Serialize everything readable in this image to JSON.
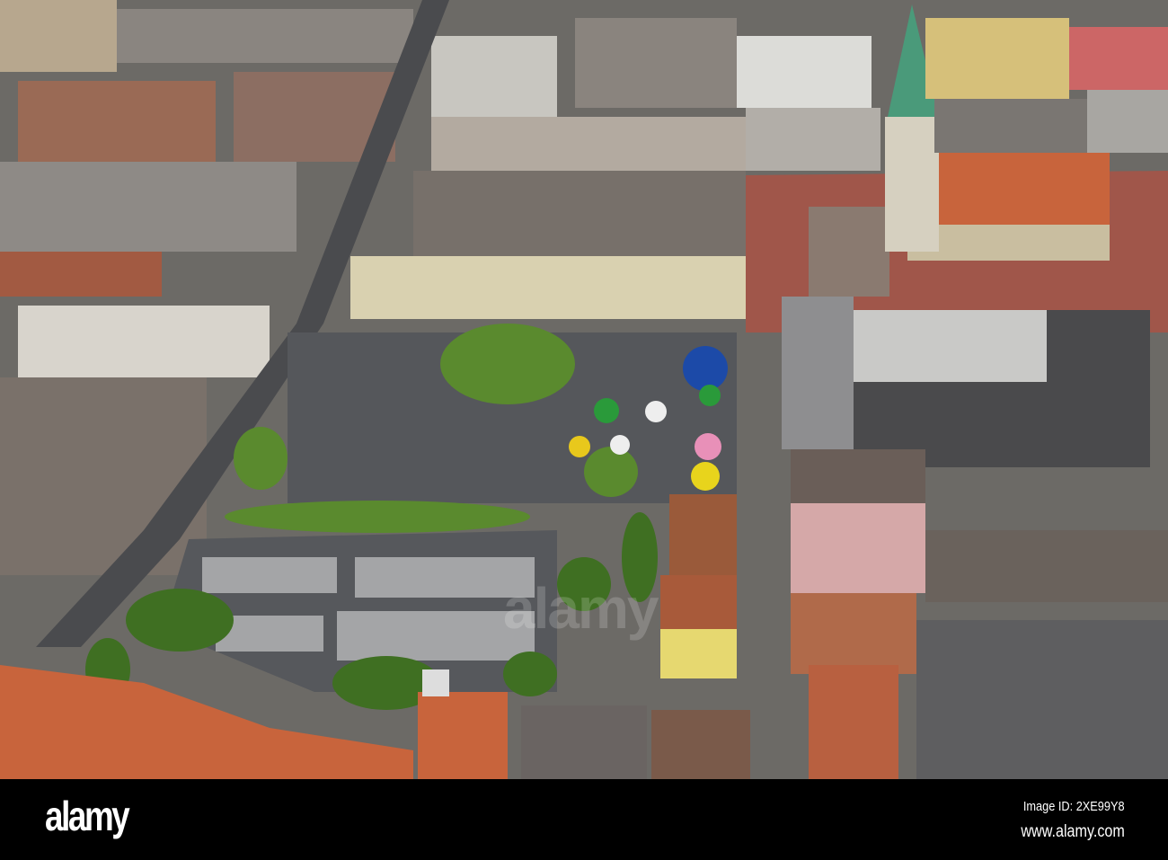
{
  "photo": {
    "subject": "Aerial view of town centre with market square, car park and church",
    "watermark": "alamy"
  },
  "footer": {
    "logo": "alamy",
    "image_id": "Image ID: 2XE99Y8",
    "website": "www.alamy.com"
  },
  "colors": {
    "roof_orange": "#c8643c",
    "church_spire": "#4a9a7a",
    "asphalt": "#5a5c60",
    "trees": "#4a7a2a",
    "plaza": "#a0564a"
  }
}
